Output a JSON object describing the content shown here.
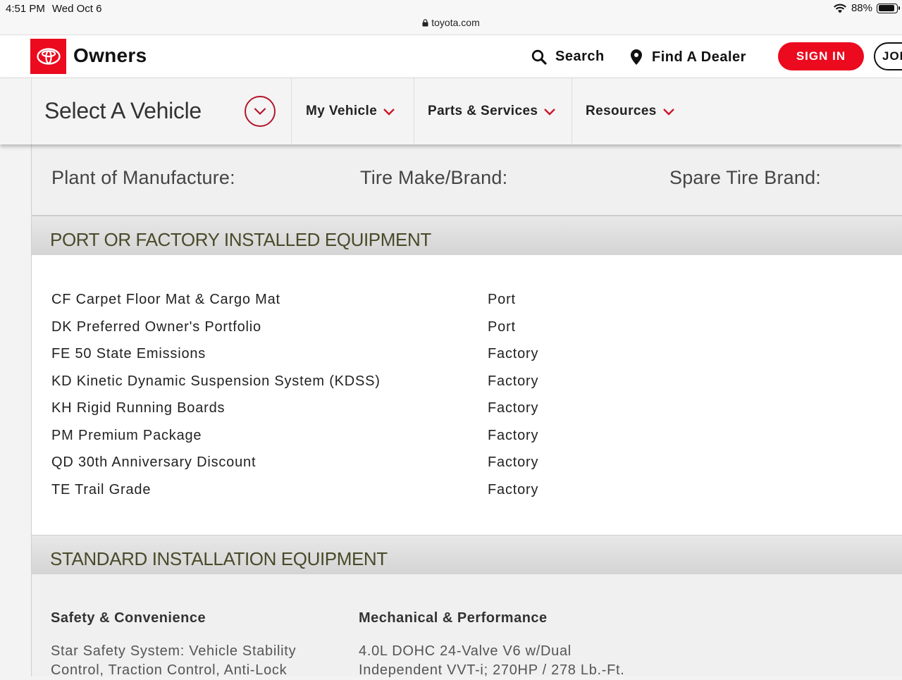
{
  "status_bar": {
    "time": "4:51 PM",
    "date": "Wed Oct 6",
    "battery": "88%",
    "battery_level": 0.88
  },
  "url_bar": {
    "domain": "toyota.com"
  },
  "header": {
    "brand": "Owners",
    "search_label": "Search",
    "dealer_label": "Find A Dealer",
    "signin_label": "SIGN IN",
    "join_label": "JOI",
    "accent_color": "#eb0a1e"
  },
  "subnav": {
    "select_vehicle": "Select A Vehicle",
    "tabs": [
      {
        "label": "My Vehicle"
      },
      {
        "label": "Parts & Services"
      },
      {
        "label": "Resources"
      }
    ]
  },
  "specs": {
    "labels": [
      "Plant of Manufacture:",
      "Tire Make/Brand:",
      "Spare Tire Brand:"
    ]
  },
  "port_factory": {
    "title": "PORT OR FACTORY INSTALLED EQUIPMENT",
    "items": [
      {
        "name": "CF Carpet Floor Mat & Cargo Mat",
        "type": "Port"
      },
      {
        "name": "DK Preferred Owner's Portfolio",
        "type": "Port"
      },
      {
        "name": "FE 50 State Emissions",
        "type": "Factory"
      },
      {
        "name": "KD Kinetic Dynamic Suspension System (KDSS)",
        "type": "Factory"
      },
      {
        "name": "KH Rigid Running Boards",
        "type": "Factory"
      },
      {
        "name": "PM Premium Package",
        "type": "Factory"
      },
      {
        "name": "QD 30th Anniversary Discount",
        "type": "Factory"
      },
      {
        "name": "TE Trail Grade",
        "type": "Factory"
      }
    ]
  },
  "standard": {
    "title": "STANDARD INSTALLATION EQUIPMENT",
    "columns": [
      {
        "heading": "Safety & Convenience",
        "line1": "Star Safety System: Vehicle Stability",
        "line2": "Control, Traction Control, Anti-Lock"
      },
      {
        "heading": "Mechanical & Performance",
        "line1": "4.0L DOHC 24-Valve V6 w/Dual",
        "line2": "Independent VVT-i; 270HP / 278 Lb.-Ft."
      }
    ]
  }
}
